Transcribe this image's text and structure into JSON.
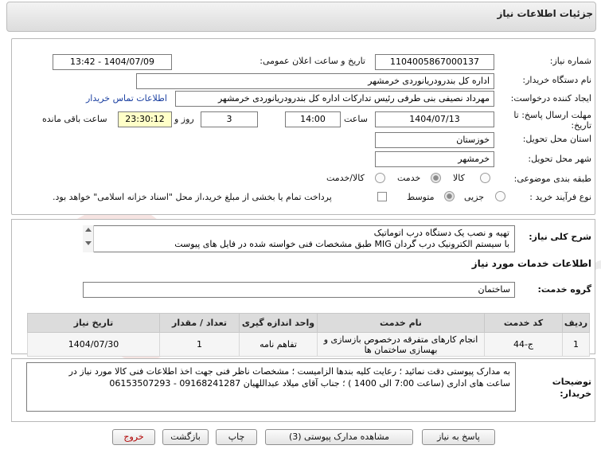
{
  "header": {
    "title": "جزئیات اطلاعات نیاز"
  },
  "form": {
    "need_number_label": "شماره نیاز:",
    "need_number": "1104005867000137",
    "announce_label": "تاریخ و ساعت اعلان عمومی:",
    "announce_value": "1404/07/09 - 13:42",
    "buyer_label": "نام دستگاه خریدار:",
    "buyer_value": "اداره کل بندرودریانوردی خرمشهر",
    "creator_label": "ایجاد کننده درخواست:",
    "creator_value": "مهرداد  نصیفی بنی طرفی رئیس تدارکات اداره کل بندرودریانوردی خرمشهر",
    "contact_link": "اطلاعات تماس خریدار",
    "deadline_label_1": "مهلت ارسال پاسخ: تا",
    "deadline_label_2": "تاریخ:",
    "deadline_date": "1404/07/13",
    "time_label": "ساعت",
    "deadline_time": "14:00",
    "days_value": "3",
    "days_label": "روز و",
    "remaining_time": "23:30:12",
    "remaining_label": "ساعت باقی مانده",
    "province_label": "استان محل تحویل:",
    "province_value": "خوزستان",
    "city_label": "شهر محل تحویل:",
    "city_value": "خرمشهر",
    "category_label": "طبقه بندی موضوعی:",
    "category_options": [
      "کالا",
      "خدمت",
      "کالا/خدمت"
    ],
    "category_selected": "خدمت",
    "process_label": "نوع فرآیند خرید :",
    "process_options": [
      "جزیی",
      "متوسط"
    ],
    "process_selected": "متوسط",
    "payment_note": "پرداخت تمام یا بخشی از مبلغ خرید،از محل \"اسناد خزانه اسلامی\" خواهد بود."
  },
  "description": {
    "label": "شرح کلی نیاز:",
    "line1": "تهیه و نصب یک دستگاه درب اتوماتیک",
    "line2": "با سیستم الکترونیک درب گردان MIG طبق مشخصات فنی خواسته شده در فایل های پیوست"
  },
  "services": {
    "section_title": "اطلاعات خدمات مورد نیاز",
    "group_label": "گروه خدمت:",
    "group_value": "ساختمان",
    "columns": [
      "ردیف",
      "کد خدمت",
      "نام خدمت",
      "واحد اندازه گیری",
      "تعداد / مقدار",
      "تاریخ نیاز"
    ],
    "rows": [
      {
        "row": "1",
        "code": "ج-44",
        "name": "انجام کارهای متفرقه درخصوص بازسازی و بهسازی ساختمان ها",
        "unit": "تفاهم نامه",
        "qty": "1",
        "date": "1404/07/30"
      }
    ]
  },
  "notes": {
    "label_1": "توضیحات",
    "label_2": "خریدار:",
    "line1": "به مدارک پیوستی دقت نمائید ؛ رعایت کلیه بندها الزامیست ؛ مشخصات ناظر فنی جهت اخذ اطلاعات فنی کالا مورد نیاز در",
    "line2": "ساعت های اداری (ساعت 7:00 الی 1400 ) ؛ جناب آقای میلاد عبداللهیان 09168241287 - 06153507293"
  },
  "buttons": {
    "respond": "پاسخ به نیاز",
    "attachments": "مشاهده مدارک پیوستی (3)",
    "print": "چاپ",
    "back": "بازگشت",
    "exit": "خروج"
  },
  "watermark": {
    "text": "AriaTender.net"
  },
  "colors": {
    "link": "#1a3fa0",
    "highlight": "#ffffc8",
    "exit_text": "#b00000"
  }
}
